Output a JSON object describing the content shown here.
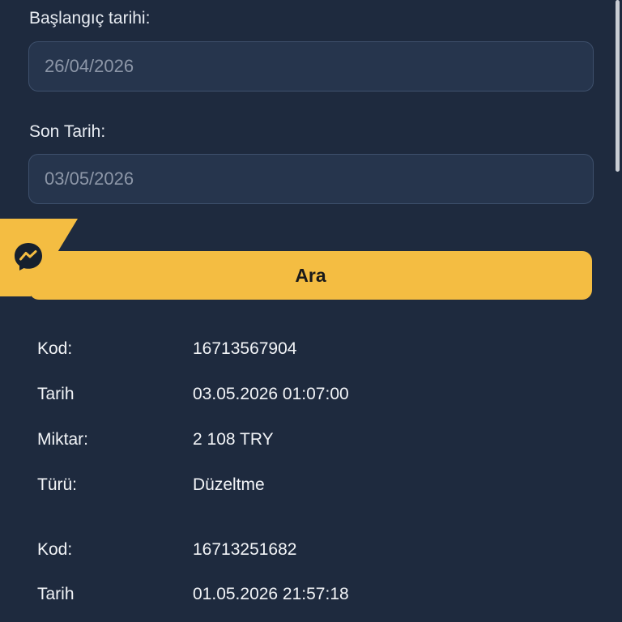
{
  "filter": {
    "start_label": "Başlangıç tarihi:",
    "start_value": "26/04/2026",
    "end_label": "Son Tarih:",
    "end_value": "03/05/2026",
    "search_label": "Ara"
  },
  "transactions": [
    {
      "fields": [
        {
          "key": "Kod:",
          "value": "16713567904"
        },
        {
          "key": "Tarih",
          "value": "03.05.2026 01:07:00"
        },
        {
          "key": "Miktar:",
          "value": "2 108 TRY"
        },
        {
          "key": "Türü:",
          "value": "Düzeltme"
        }
      ]
    },
    {
      "fields": [
        {
          "key": "Kod:",
          "value": "16713251682"
        },
        {
          "key": "Tarih",
          "value": "01.05.2026 21:57:18"
        }
      ]
    }
  ],
  "icons": {
    "chat": "messenger-icon"
  },
  "colors": {
    "background": "#1e2a3e",
    "accent": "#f4bd42",
    "input_bg": "#26354d"
  }
}
